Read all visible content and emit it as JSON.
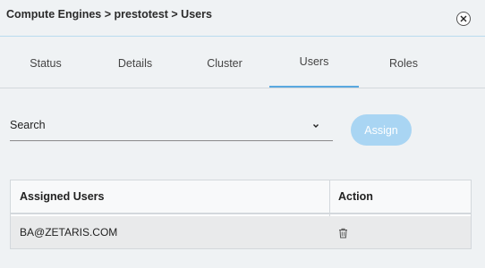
{
  "header": {
    "breadcrumb": "Compute Engines > prestotest > Users",
    "close_icon": "close-icon"
  },
  "tabs": [
    {
      "label": "Status"
    },
    {
      "label": "Details"
    },
    {
      "label": "Cluster"
    },
    {
      "label": "Users",
      "active": true
    },
    {
      "label": "Roles"
    }
  ],
  "search": {
    "label": "Search",
    "icon": "chevron-down-icon"
  },
  "assign_button": {
    "label": "Assign",
    "color": "#a9d5f3"
  },
  "table": {
    "columns": [
      "Assigned Users",
      "Action"
    ],
    "rows": [
      {
        "user": "BA@ZETARIS.COM",
        "action_icon": "trash-icon"
      }
    ]
  },
  "colors": {
    "accent": "#5aa9e0",
    "header_divider": "#b9dcef",
    "background": "#eff2f4"
  }
}
